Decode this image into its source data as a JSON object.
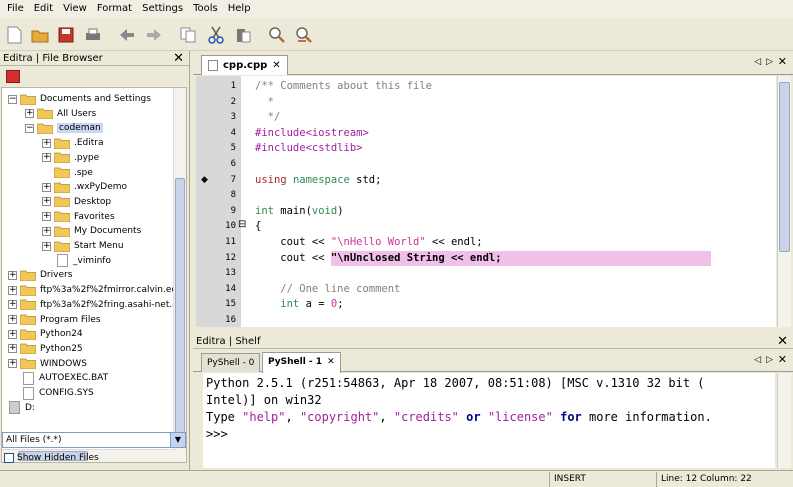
{
  "menu": [
    "File",
    "Edit",
    "View",
    "Format",
    "Settings",
    "Tools",
    "Help"
  ],
  "toolbar_icons": [
    "new-file-icon",
    "open-folder-icon",
    "save-icon",
    "print-icon",
    "back-arrow-icon",
    "forward-arrow-icon",
    "copy-icon",
    "cut-icon",
    "paste-icon",
    "find-icon",
    "find-replace-icon"
  ],
  "file_browser": {
    "title": "Editra | File Browser",
    "close": "✕",
    "items": [
      {
        "label": "Documents and Settings",
        "depth": 0,
        "exp": "−",
        "type": "folder"
      },
      {
        "label": "All Users",
        "depth": 1,
        "exp": "+",
        "type": "folder"
      },
      {
        "label": "codeman",
        "depth": 1,
        "exp": "−",
        "type": "folder",
        "selected": true
      },
      {
        "label": ".Editra",
        "depth": 2,
        "exp": "+",
        "type": "folder"
      },
      {
        "label": ".pype",
        "depth": 2,
        "exp": "+",
        "type": "folder"
      },
      {
        "label": ".spe",
        "depth": 2,
        "exp": "",
        "type": "folder"
      },
      {
        "label": ".wxPyDemo",
        "depth": 2,
        "exp": "+",
        "type": "folder"
      },
      {
        "label": "Desktop",
        "depth": 2,
        "exp": "+",
        "type": "folder"
      },
      {
        "label": "Favorites",
        "depth": 2,
        "exp": "+",
        "type": "folder"
      },
      {
        "label": "My Documents",
        "depth": 2,
        "exp": "+",
        "type": "folder"
      },
      {
        "label": "Start Menu",
        "depth": 2,
        "exp": "+",
        "type": "folder"
      },
      {
        "label": "_viminfo",
        "depth": 2,
        "exp": "",
        "type": "file"
      },
      {
        "label": "Drivers",
        "depth": 0,
        "exp": "+",
        "type": "folder"
      },
      {
        "label": "ftp%3a%2f%2fmirror.calvin.ed",
        "depth": 0,
        "exp": "+",
        "type": "folder"
      },
      {
        "label": "ftp%3a%2f%2fring.asahi-net.c",
        "depth": 0,
        "exp": "+",
        "type": "folder"
      },
      {
        "label": "Program Files",
        "depth": 0,
        "exp": "+",
        "type": "folder"
      },
      {
        "label": "Python24",
        "depth": 0,
        "exp": "+",
        "type": "folder"
      },
      {
        "label": "Python25",
        "depth": 0,
        "exp": "+",
        "type": "folder"
      },
      {
        "label": "WINDOWS",
        "depth": 0,
        "exp": "+",
        "type": "folder"
      },
      {
        "label": "AUTOEXEC.BAT",
        "depth": 0,
        "exp": "",
        "type": "file"
      },
      {
        "label": "CONFIG.SYS",
        "depth": 0,
        "exp": "",
        "type": "file"
      },
      {
        "label": "D:",
        "depth": -1,
        "exp": "",
        "type": "drive"
      }
    ],
    "filter": "All Files (*.*)",
    "show_hidden": "Show Hidden Files"
  },
  "editor": {
    "tab": "cpp.cpp",
    "tab_close": "✕",
    "lines": [
      {
        "n": "1",
        "segs": [
          [
            "/** Comments about this file",
            "#808080"
          ]
        ]
      },
      {
        "n": "2",
        "segs": [
          [
            "  *",
            "#808080"
          ]
        ]
      },
      {
        "n": "3",
        "segs": [
          [
            "  */",
            "#808080"
          ]
        ]
      },
      {
        "n": "4",
        "segs": [
          [
            "#include",
            "#a020a0"
          ],
          [
            "<iostream>",
            "#a020a0"
          ]
        ]
      },
      {
        "n": "5",
        "segs": [
          [
            "#include",
            "#a020a0"
          ],
          [
            "<cstdlib>",
            "#a020a0"
          ]
        ]
      },
      {
        "n": "6",
        "segs": []
      },
      {
        "n": "7",
        "segs": [
          [
            "using",
            "#a52a2a"
          ],
          [
            " ",
            ""
          ],
          [
            "namespace",
            "#2e8b57"
          ],
          [
            " std;",
            "#000000"
          ]
        ],
        "marker": true
      },
      {
        "n": "8",
        "segs": []
      },
      {
        "n": "9",
        "segs": [
          [
            "int",
            "#2e8b57"
          ],
          [
            " main(",
            "#000000"
          ],
          [
            "void",
            "#2e8b57"
          ],
          [
            ")",
            "#000000"
          ]
        ]
      },
      {
        "n": "10",
        "segs": [
          [
            "{",
            "#000000"
          ]
        ],
        "fold": "⊟"
      },
      {
        "n": "11",
        "segs": [
          [
            "    cout << ",
            "#000000"
          ],
          [
            "\"\\nHello World\"",
            "#cc3399"
          ],
          [
            " << endl;",
            "#000000"
          ]
        ]
      },
      {
        "n": "12",
        "segs": [
          [
            "    cout << ",
            "#000000"
          ],
          [
            "\"\\nUnclosed String << endl;",
            "#000000"
          ]
        ],
        "highlight": true
      },
      {
        "n": "13",
        "segs": []
      },
      {
        "n": "14",
        "segs": [
          [
            "    // One line comment",
            "#808080"
          ]
        ]
      },
      {
        "n": "15",
        "segs": [
          [
            "    int",
            "#2e8b57"
          ],
          [
            " a = ",
            "#000000"
          ],
          [
            "0",
            "#cc3399"
          ],
          [
            ";",
            "#000000"
          ]
        ]
      },
      {
        "n": "16",
        "segs": []
      }
    ]
  },
  "shelf": {
    "title": "Editra | Shelf",
    "close": "✕",
    "tabs": [
      "PyShell - 0",
      "PyShell - 1"
    ],
    "tab_close": "✕",
    "lines": [
      [
        [
          "Python 2.5.1 (r251:54863, Apr 18 2007, 08:51:08) [MSC v.1310 32 bit (",
          "#000000"
        ]
      ],
      [
        [
          "Intel)] on win32",
          "#000000"
        ]
      ],
      [
        [
          "Type ",
          "#000000"
        ],
        [
          "\"help\"",
          "#a020a0"
        ],
        [
          ", ",
          "#000000"
        ],
        [
          "\"copyright\"",
          "#a020a0"
        ],
        [
          ", ",
          "#000000"
        ],
        [
          "\"credits\"",
          "#a020a0"
        ],
        [
          " ",
          "#000000"
        ],
        [
          "or",
          "#00008b"
        ],
        [
          " ",
          "#000000"
        ],
        [
          "\"license\"",
          "#a020a0"
        ],
        [
          " ",
          "#000000"
        ],
        [
          "for",
          "#00008b"
        ],
        [
          " more information.",
          "#000000"
        ]
      ],
      [
        [
          ">>>",
          "#000000"
        ]
      ]
    ]
  },
  "status": {
    "mode": "INSERT",
    "position": "Line: 12  Column: 22"
  }
}
